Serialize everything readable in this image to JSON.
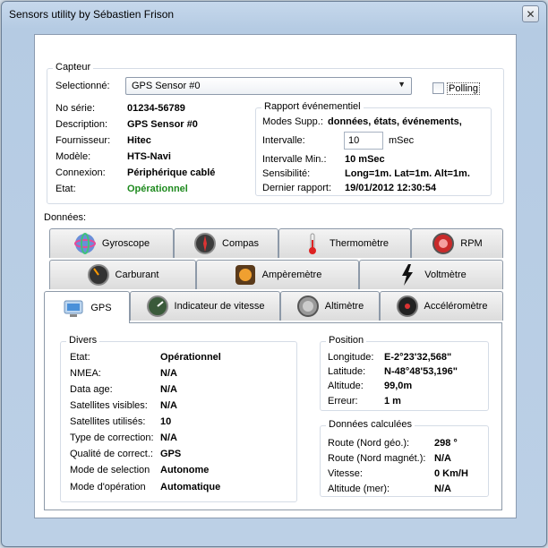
{
  "window": {
    "title": "Sensors utility by Sébastien Frison"
  },
  "capteur": {
    "group_title": "Capteur",
    "select_label": "Selectionné:",
    "select_value": "GPS Sensor #0",
    "polling_label": "Polling",
    "fields": [
      {
        "label": "No série:",
        "value": "01234-56789"
      },
      {
        "label": "Description:",
        "value": "GPS Sensor #0"
      },
      {
        "label": "Fournisseur:",
        "value": "Hitec"
      },
      {
        "label": "Modèle:",
        "value": "HTS-Navi"
      },
      {
        "label": "Connexion:",
        "value": "Périphérique cablé"
      },
      {
        "label": "Etat:",
        "value": "Opérationnel"
      }
    ],
    "status_color": "#1e8a1e"
  },
  "rapport": {
    "group_title": "Rapport événementiel",
    "modes_label": "Modes Supp.:",
    "modes_value": "données, états, événements,",
    "intervalle_label": "Intervalle:",
    "intervalle_value": "10",
    "intervalle_unit": "mSec",
    "intervalle_min_label": "Intervalle Min.:",
    "intervalle_min_value": "10 mSec",
    "sensibilite_label": "Sensibilité:",
    "sensibilite_value": "Long=1m. Lat=1m. Alt=1m.",
    "dernier_label": "Dernier rapport:",
    "dernier_value": "19/01/2012 12:30:54"
  },
  "donnees_label": "Données:",
  "tabs": {
    "row1": [
      "Gyroscope",
      "Compas",
      "Thermomètre",
      "RPM"
    ],
    "row2": [
      "Carburant",
      "Ampèremètre",
      "Voltmètre"
    ],
    "row3": [
      "GPS",
      "Indicateur de vitesse",
      "Altimètre",
      "Accéléromètre"
    ],
    "active": "GPS"
  },
  "divers": {
    "group_title": "Divers",
    "fields": [
      {
        "label": "Etat:",
        "value": "Opérationnel"
      },
      {
        "label": "NMEA:",
        "value": "N/A"
      },
      {
        "label": "Data age:",
        "value": "N/A"
      },
      {
        "label": "Satellites visibles:",
        "value": "N/A"
      },
      {
        "label": "Satellites utilisés:",
        "value": "10"
      },
      {
        "label": "Type de correction:",
        "value": "N/A"
      },
      {
        "label": "Qualité de correct.:",
        "value": "GPS"
      },
      {
        "label": "Mode de selection",
        "value": "Autonome"
      },
      {
        "label": "Mode d'opération",
        "value": "Automatique"
      }
    ]
  },
  "position": {
    "group_title": "Position",
    "fields": [
      {
        "label": "Longitude:",
        "value": "E-2°23'32,568\""
      },
      {
        "label": "Latitude:",
        "value": "N-48°48'53,196\""
      },
      {
        "label": "Altitude:",
        "value": "99,0m"
      },
      {
        "label": "Erreur:",
        "value": "1 m"
      }
    ]
  },
  "calculees": {
    "group_title": "Données calculées",
    "fields": [
      {
        "label": "Route (Nord géo.):",
        "value": "298 °"
      },
      {
        "label": "Route (Nord magnét.):",
        "value": "N/A"
      },
      {
        "label": "Vitesse:",
        "value": "0 Km/H"
      },
      {
        "label": "Altitude (mer):",
        "value": "N/A"
      }
    ]
  }
}
